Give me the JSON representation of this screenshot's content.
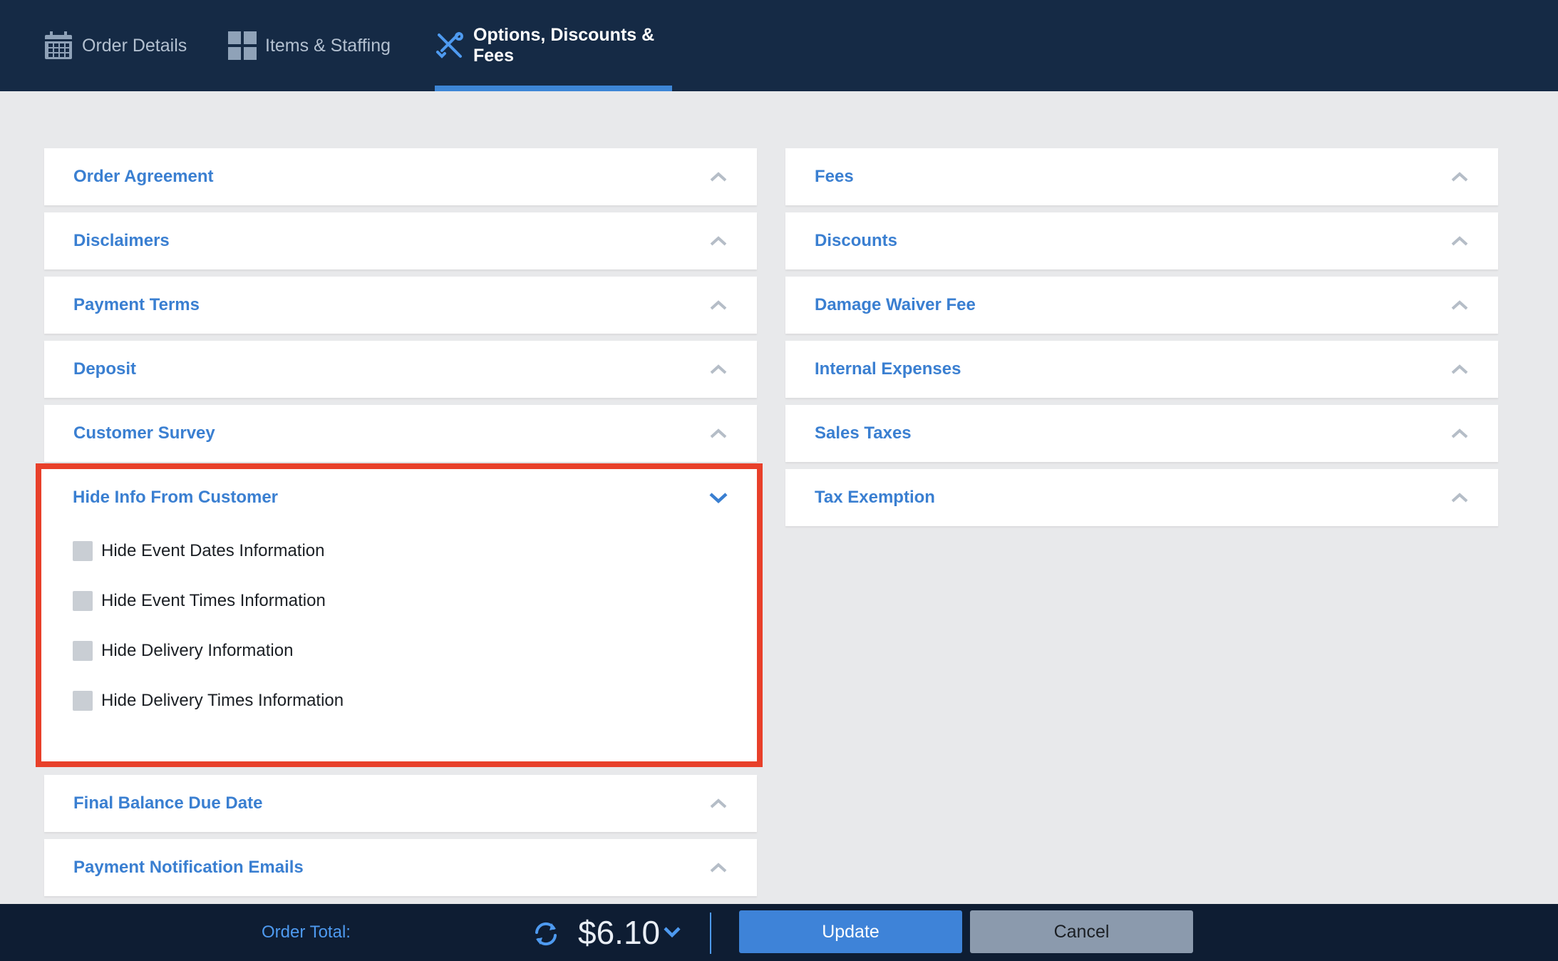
{
  "tabs": [
    {
      "label": "Order Details",
      "icon": "calendar-icon",
      "active": false
    },
    {
      "label": "Items & Staffing",
      "icon": "grid-icon",
      "active": false
    },
    {
      "label": "Options, Discounts & Fees",
      "icon": "tools-icon",
      "active": true
    }
  ],
  "left_panels": {
    "order_agreement": "Order Agreement",
    "disclaimers": "Disclaimers",
    "payment_terms": "Payment Terms",
    "deposit": "Deposit",
    "customer_survey": "Customer Survey",
    "hide_info": "Hide Info From Customer",
    "final_balance": "Final Balance Due Date",
    "payment_emails": "Payment Notification Emails"
  },
  "right_panels": {
    "fees": "Fees",
    "discounts": "Discounts",
    "damage_waiver": "Damage Waiver Fee",
    "internal_expenses": "Internal Expenses",
    "sales_taxes": "Sales Taxes",
    "tax_exemption": "Tax Exemption"
  },
  "hide_info_options": [
    {
      "label": "Hide Event Dates Information",
      "checked": false
    },
    {
      "label": "Hide Event Times Information",
      "checked": false
    },
    {
      "label": "Hide Delivery Information",
      "checked": false
    },
    {
      "label": "Hide Delivery Times Information",
      "checked": false
    }
  ],
  "footer": {
    "total_label": "Order Total:",
    "total_amount": "$6.10",
    "update_label": "Update",
    "cancel_label": "Cancel"
  },
  "colors": {
    "nav_bg": "#152a45",
    "accent": "#3d86d6",
    "panel_title": "#3a7fd1",
    "highlight_border": "#e8402a"
  }
}
